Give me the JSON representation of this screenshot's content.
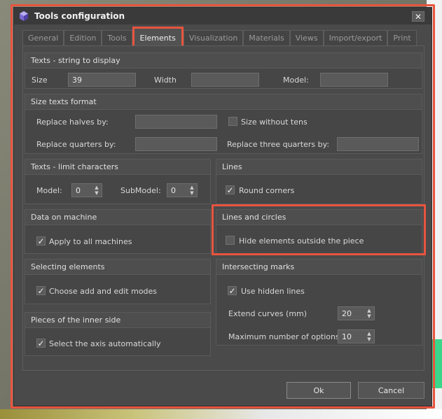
{
  "window": {
    "title": "Tools configuration",
    "close_glyph": "✕"
  },
  "tabs": [
    {
      "label": "General",
      "active": false
    },
    {
      "label": "Edition",
      "active": false
    },
    {
      "label": "Tools",
      "active": false
    },
    {
      "label": "Elements",
      "active": true
    },
    {
      "label": "Visualization",
      "active": false
    },
    {
      "label": "Materials",
      "active": false
    },
    {
      "label": "Views",
      "active": false
    },
    {
      "label": "Import/export",
      "active": false
    },
    {
      "label": "Print",
      "active": false
    }
  ],
  "texts_string": {
    "title": "Texts - string to display",
    "size_label": "Size",
    "size_value": "39",
    "width_label": "Width",
    "width_value": "",
    "model_label": "Model:",
    "model_value": ""
  },
  "size_texts_format": {
    "title": "Size texts format",
    "replace_halves_label": "Replace halves by:",
    "replace_halves_value": "",
    "size_without_tens_label": "Size without tens",
    "size_without_tens_checked": false,
    "replace_quarters_label": "Replace quarters by:",
    "replace_quarters_value": "",
    "replace_three_quarters_label": "Replace three quarters by:",
    "replace_three_quarters_value": ""
  },
  "texts_limit": {
    "title": "Texts - limit characters",
    "model_label": "Model:",
    "model_value": "0",
    "submodel_label": "SubModel:",
    "submodel_value": "0"
  },
  "lines": {
    "title": "Lines",
    "round_corners_label": "Round corners",
    "round_corners_checked": true
  },
  "data_on_machine": {
    "title": "Data on machine",
    "apply_all_label": "Apply to all machines",
    "apply_all_checked": true
  },
  "lines_circles": {
    "title": "Lines and circles",
    "hide_outside_label": "Hide elements outside the piece",
    "hide_outside_checked": false
  },
  "selecting": {
    "title": "Selecting elements",
    "choose_modes_label": "Choose add and edit modes",
    "choose_modes_checked": true
  },
  "intersecting": {
    "title": "Intersecting marks",
    "use_hidden_label": "Use hidden lines",
    "use_hidden_checked": true,
    "extend_label": "Extend curves (mm)",
    "extend_value": "20",
    "max_options_label": "Maximum number of options:",
    "max_options_value": "10"
  },
  "inner_side": {
    "title": "Pieces of the inner side",
    "select_axis_label": "Select the axis automatically",
    "select_axis_checked": true
  },
  "buttons": {
    "ok": "Ok",
    "cancel": "Cancel"
  },
  "glyphs": {
    "check": "✓",
    "up": "▲",
    "down": "▼"
  },
  "colors": {
    "highlight": "#e8543e",
    "window_bg": "#4a4a4a",
    "titlebar": "#3a3a3a"
  }
}
